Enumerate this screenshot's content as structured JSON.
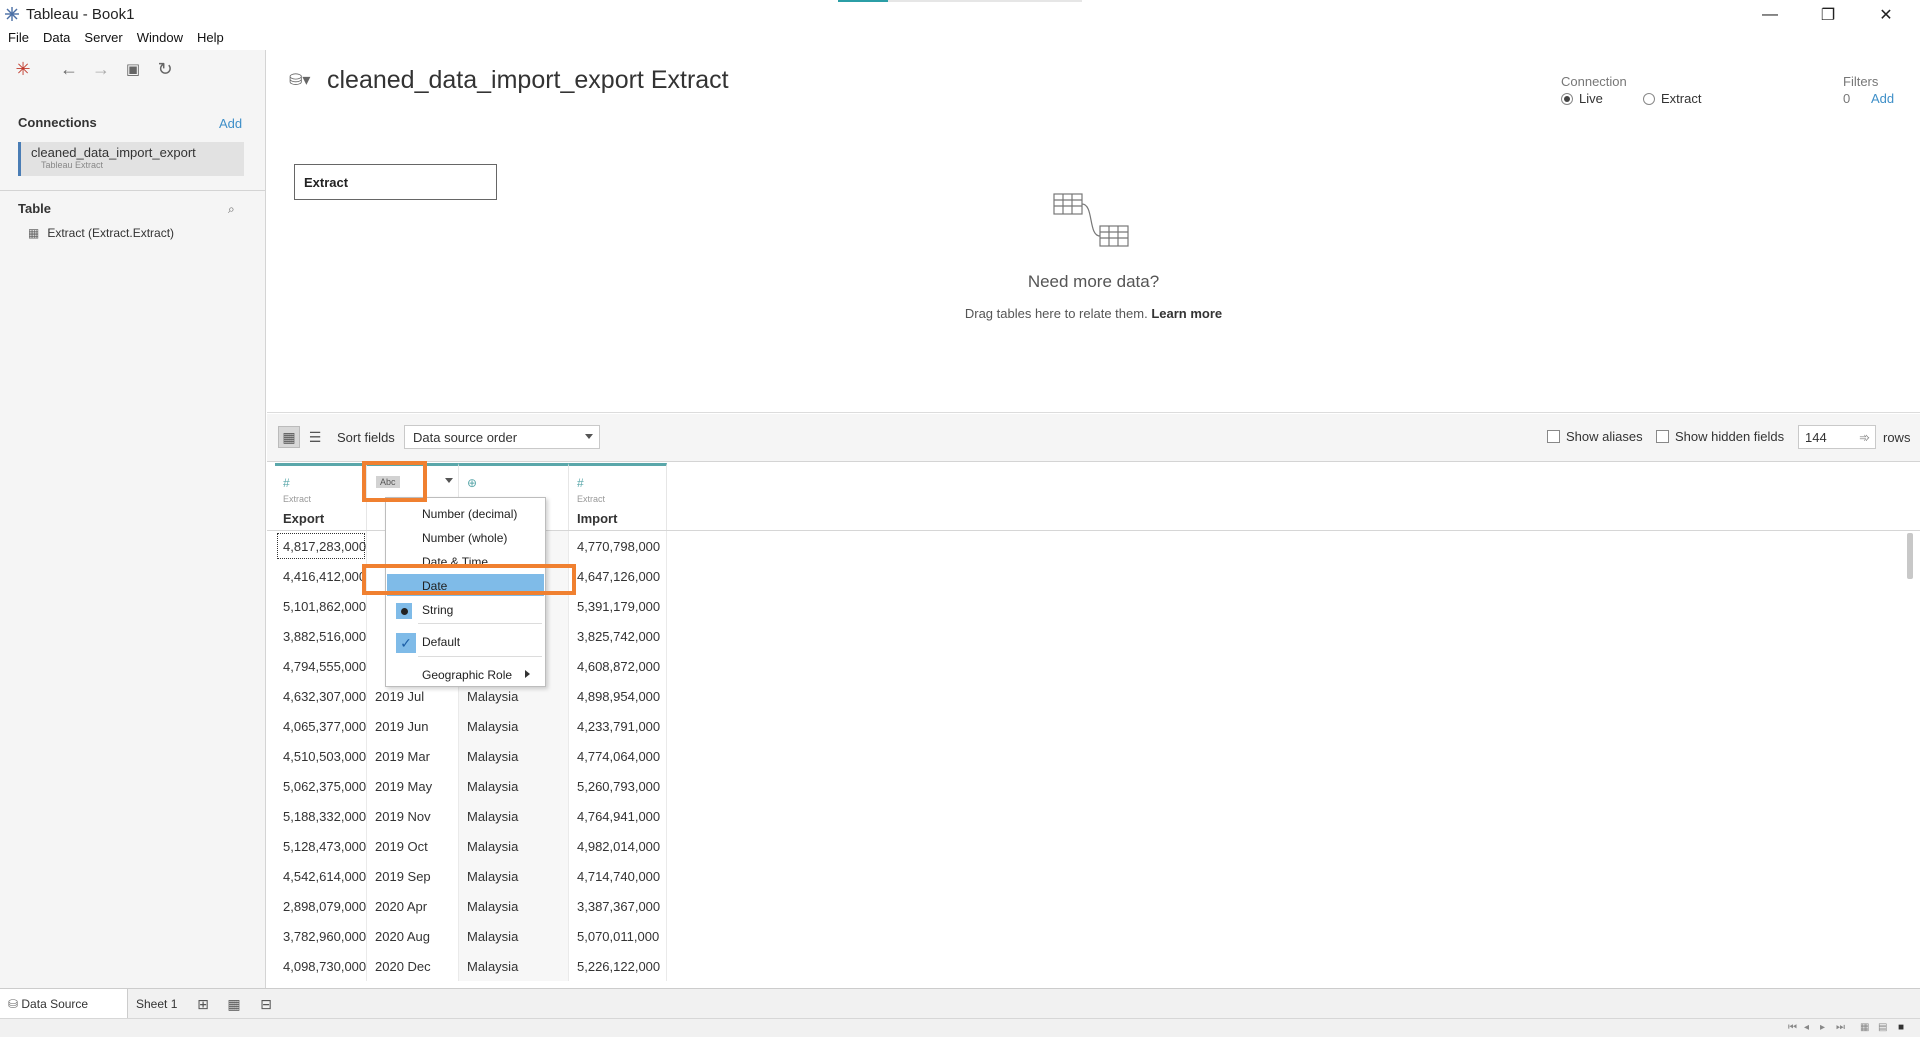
{
  "window": {
    "title": "Tableau - Book1",
    "minimize": "—",
    "restore": "❐",
    "close": "✕"
  },
  "menu": [
    "File",
    "Data",
    "Server",
    "Window",
    "Help"
  ],
  "left_panel": {
    "connections_title": "Connections",
    "connections_add": "Add",
    "connection": {
      "name": "cleaned_data_import_export",
      "type": "Tableau Extract"
    },
    "table_title": "Table",
    "table_item": "Extract (Extract.Extract)"
  },
  "canvas": {
    "datasource_title": "cleaned_data_import_export Extract",
    "connection_label": "Connection",
    "connection_options": [
      {
        "label": "Live",
        "selected": true
      },
      {
        "label": "Extract",
        "selected": false
      }
    ],
    "filters_label": "Filters",
    "filters_count": "0",
    "filters_add": "Add",
    "extract_table": "Extract",
    "need_more_title": "Need more data?",
    "need_more_text": "Drag tables here to relate them.",
    "learn_more": "Learn more"
  },
  "grid_toolbar": {
    "sort_label": "Sort fields",
    "sort_value": "Data source order",
    "show_aliases": "Show aliases",
    "show_hidden": "Show hidden fields",
    "rows_value": "144",
    "rows_label": "rows"
  },
  "grid": {
    "columns": [
      {
        "type_icon": "#",
        "source": "Extract",
        "name": "Export"
      },
      {
        "type_icon": "Abc",
        "source": "",
        "name": ""
      },
      {
        "type_icon": "⊕",
        "source": "",
        "name": ""
      },
      {
        "type_icon": "#",
        "source": "Extract",
        "name": "Import"
      }
    ],
    "rows": [
      [
        "4,817,283,000",
        "",
        "",
        "4,770,798,000"
      ],
      [
        "4,416,412,000",
        "",
        "",
        "4,647,126,000"
      ],
      [
        "5,101,862,000",
        "",
        "",
        "5,391,179,000"
      ],
      [
        "3,882,516,000",
        "",
        "",
        "3,825,742,000"
      ],
      [
        "4,794,555,000",
        "",
        "",
        "4,608,872,000"
      ],
      [
        "4,632,307,000",
        "2019 Jul",
        "Malaysia",
        "4,898,954,000"
      ],
      [
        "4,065,377,000",
        "2019 Jun",
        "Malaysia",
        "4,233,791,000"
      ],
      [
        "4,510,503,000",
        "2019 Mar",
        "Malaysia",
        "4,774,064,000"
      ],
      [
        "5,062,375,000",
        "2019 May",
        "Malaysia",
        "5,260,793,000"
      ],
      [
        "5,188,332,000",
        "2019 Nov",
        "Malaysia",
        "4,764,941,000"
      ],
      [
        "5,128,473,000",
        "2019 Oct",
        "Malaysia",
        "4,982,014,000"
      ],
      [
        "4,542,614,000",
        "2019 Sep",
        "Malaysia",
        "4,714,740,000"
      ],
      [
        "2,898,079,000",
        "2020 Apr",
        "Malaysia",
        "3,387,367,000"
      ],
      [
        "3,782,960,000",
        "2020 Aug",
        "Malaysia",
        "5,070,011,000"
      ],
      [
        "4,098,730,000",
        "2020 Dec",
        "Malaysia",
        "5,226,122,000"
      ]
    ]
  },
  "context_menu": {
    "items": [
      "Number (decimal)",
      "Number (whole)",
      "Date & Time",
      "Date",
      "String",
      "Default",
      "Geographic Role"
    ],
    "highlighted": "Date"
  },
  "tabs": {
    "data_source": "Data Source",
    "sheet": "Sheet 1"
  },
  "colors": {
    "accent": "#5aa7aa",
    "link": "#3e8fc8",
    "highlight": "#7fbbe8",
    "annotation": "#f08030"
  }
}
